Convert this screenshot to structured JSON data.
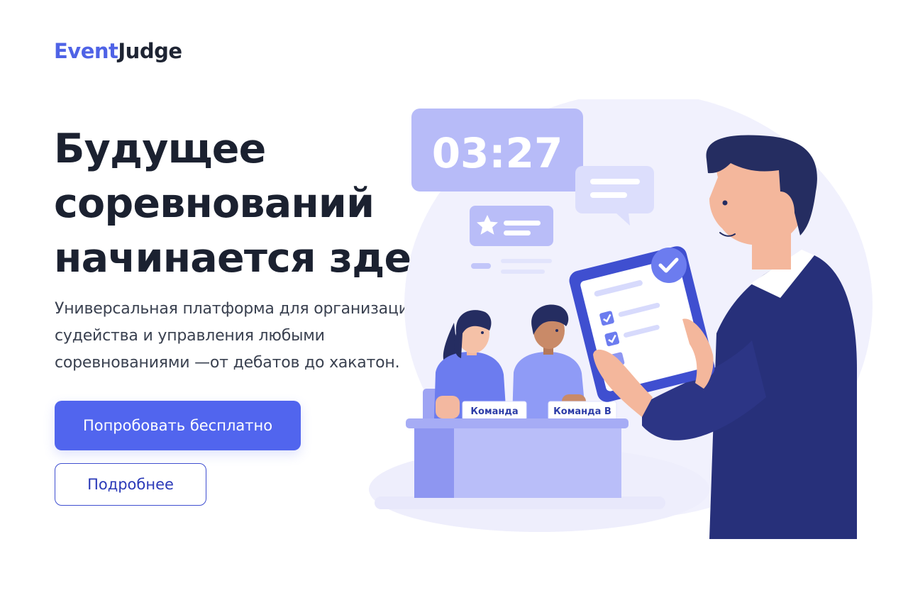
{
  "brand": {
    "part1": "Event",
    "part2": "Judge"
  },
  "hero": {
    "title_lines": [
      "Будущее",
      "соревнований",
      "начинается здесь"
    ],
    "subtitle_lines": [
      "Универсальная платформа для организации,",
      "судейства и управления любыми",
      "соревнованиями —от дебатов до хакатон."
    ],
    "primary_button": "Попробовать бесплатно",
    "secondary_button": "Подробнее"
  },
  "illustration": {
    "timer": "03:27",
    "team_a": "Команда",
    "team_b": "Команда B"
  },
  "colors": {
    "accent": "#5165ee",
    "text": "#1b2130",
    "suit": "#27307a",
    "illustration_light": "#c9cdfb"
  }
}
